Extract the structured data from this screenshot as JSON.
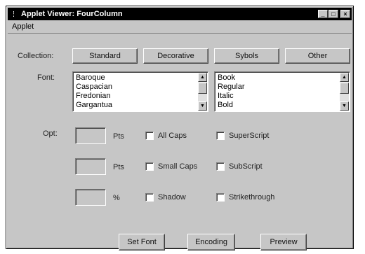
{
  "window": {
    "title": "Applet Viewer: FourColumn",
    "controls": {
      "minimize": "_",
      "maximize": "□",
      "close": "×"
    }
  },
  "menubar": {
    "items": [
      "Applet"
    ]
  },
  "collection": {
    "label": "Collection:",
    "buttons": [
      "Standard",
      "Decorative",
      "Sybols",
      "Other"
    ]
  },
  "font": {
    "label": "Font:",
    "families": [
      "Baroque",
      "Caspacian",
      "Fredonian",
      "Gargantua"
    ],
    "styles": [
      "Book",
      "Regular",
      "Italic",
      "Bold"
    ]
  },
  "options": {
    "label": "Opt:",
    "rows": [
      {
        "unit": "Pts",
        "check1": "All Caps",
        "check2": "SuperScript"
      },
      {
        "unit": "Pts",
        "check1": "Small Caps",
        "check2": "SubScript"
      },
      {
        "unit": "%",
        "check1": "Shadow",
        "check2": "Strikethrough"
      }
    ]
  },
  "actions": {
    "set_font": "Set Font",
    "encoding": "Encoding",
    "preview": "Preview"
  }
}
